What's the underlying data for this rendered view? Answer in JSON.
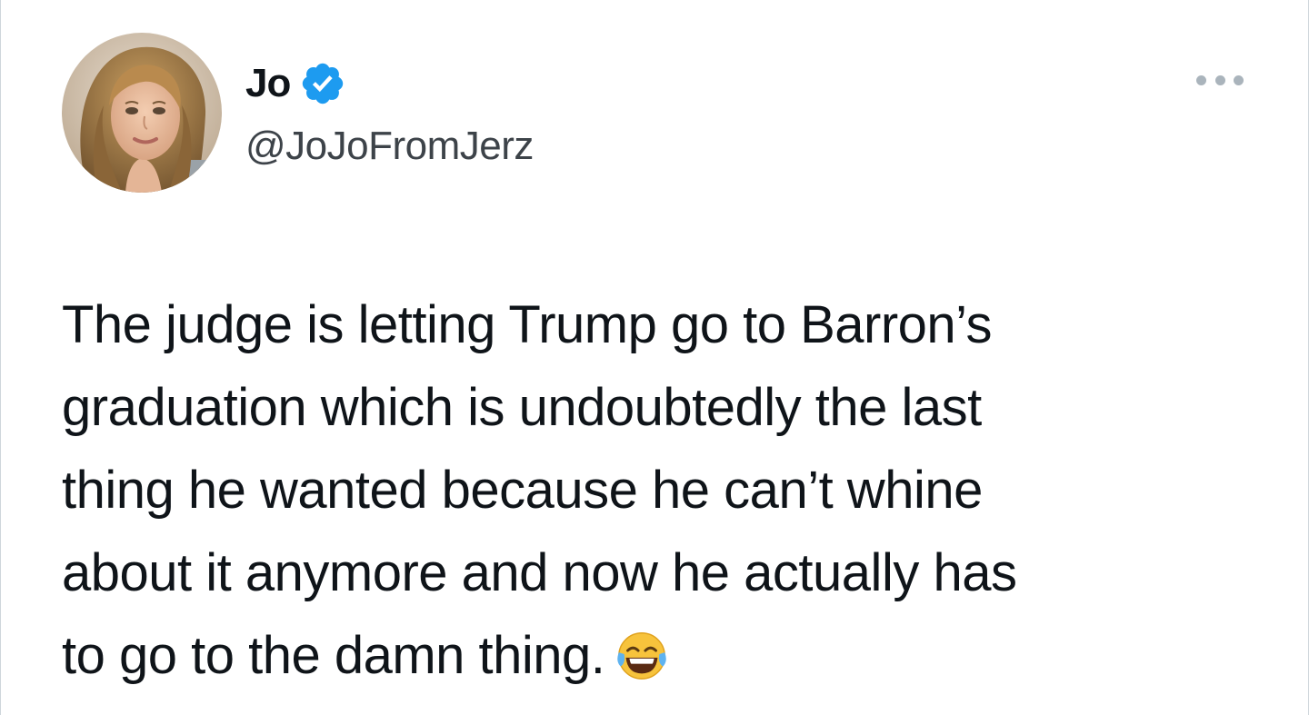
{
  "author": {
    "display_name": "Jo",
    "handle": "@JoJoFromJerz",
    "verified": true,
    "verified_icon": "verified-badge-icon",
    "verified_color": "#1d9bf0"
  },
  "menu": {
    "icon": "more-options-icon"
  },
  "tweet": {
    "lines": [
      "The judge is letting Trump go to Barron’s",
      "graduation which is undoubtedly the last",
      "thing he wanted because he can’t whine",
      "about it anymore and now he actually has",
      "to go to the damn thing."
    ],
    "emoji": "face-with-tears-of-joy-icon"
  },
  "colors": {
    "text": "#0f1419",
    "secondary_text": "#3d4349",
    "background": "#ffffff"
  }
}
